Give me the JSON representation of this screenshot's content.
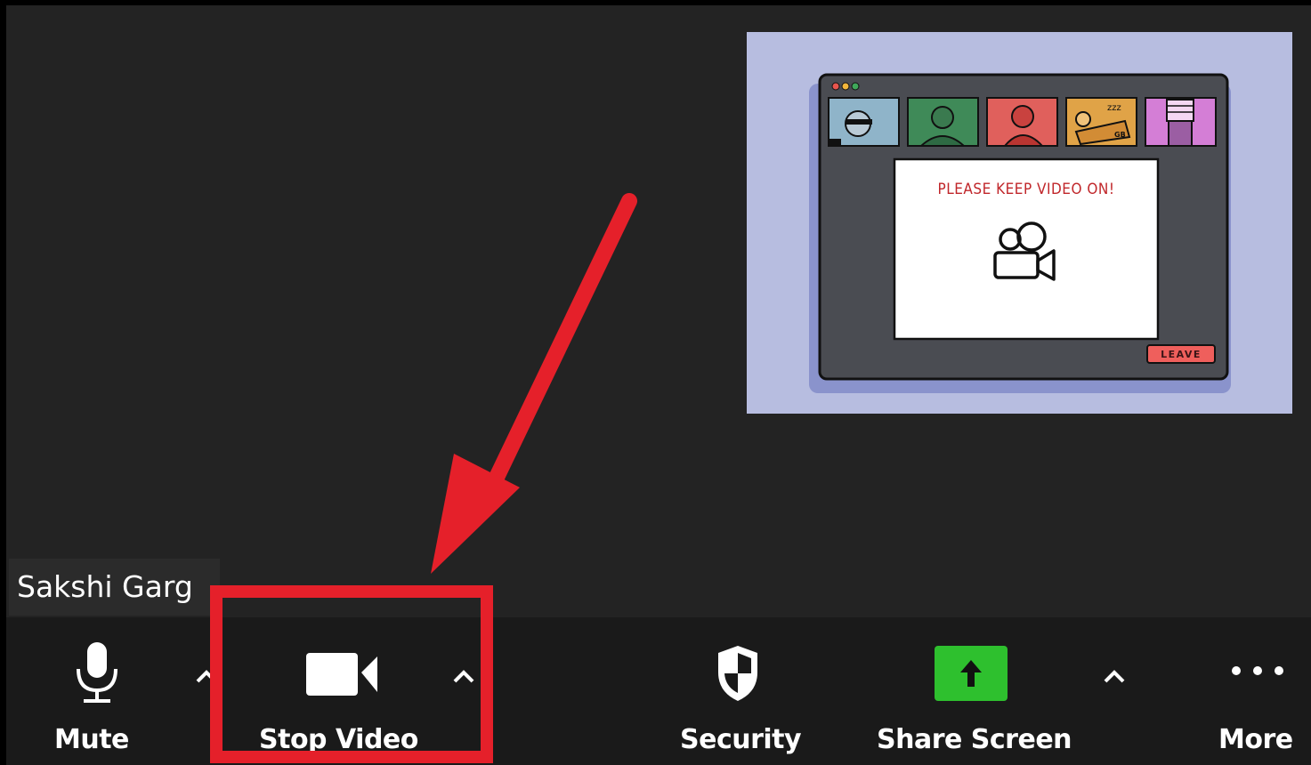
{
  "participant": {
    "name": "Sakshi Garg"
  },
  "thumbnail": {
    "note_text": "PLEASE KEEP VIDEO ON!",
    "leave_label": "LEAVE",
    "zzz_text": "zzz",
    "bag_text": "GB"
  },
  "toolbar": {
    "mute_label": "Mute",
    "stop_video_label": "Stop Video",
    "security_label": "Security",
    "share_screen_label": "Share Screen",
    "more_label": "More"
  },
  "colors": {
    "annotation_red": "#e5202a",
    "share_green": "#2ec02e",
    "toolbar_bg": "#1a1a1a",
    "meeting_bg": "#232323"
  },
  "icons": [
    "microphone-icon",
    "video-camera-icon",
    "shield-icon",
    "share-arrow-icon",
    "ellipsis-icon",
    "caret-up-icon"
  ]
}
